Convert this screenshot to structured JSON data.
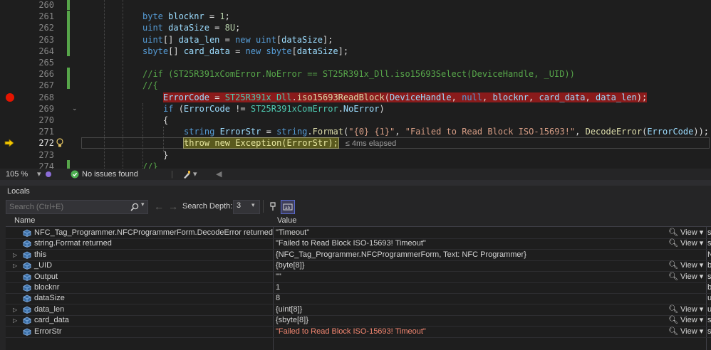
{
  "editor": {
    "lines": [
      {
        "num": "260",
        "tokens": []
      },
      {
        "num": "261",
        "tokens": [
          [
            "kw",
            "byte "
          ],
          [
            "var",
            "blocknr"
          ],
          [
            "pl",
            " = "
          ],
          [
            "num",
            "1"
          ],
          [
            "pl",
            ";"
          ]
        ]
      },
      {
        "num": "262",
        "tokens": [
          [
            "kw",
            "uint "
          ],
          [
            "var",
            "dataSize"
          ],
          [
            "pl",
            " = "
          ],
          [
            "num",
            "8U"
          ],
          [
            "pl",
            ";"
          ]
        ]
      },
      {
        "num": "263",
        "tokens": [
          [
            "kw",
            "uint"
          ],
          [
            "pl",
            "[] "
          ],
          [
            "var",
            "data_len"
          ],
          [
            "pl",
            " = "
          ],
          [
            "kw",
            "new "
          ],
          [
            "kw",
            "uint"
          ],
          [
            "pl",
            "["
          ],
          [
            "var",
            "dataSize"
          ],
          [
            "pl",
            "];"
          ]
        ]
      },
      {
        "num": "264",
        "tokens": [
          [
            "kw",
            "sbyte"
          ],
          [
            "pl",
            "[] "
          ],
          [
            "var",
            "card_data"
          ],
          [
            "pl",
            " = "
          ],
          [
            "kw",
            "new "
          ],
          [
            "kw",
            "sbyte"
          ],
          [
            "pl",
            "["
          ],
          [
            "var",
            "dataSize"
          ],
          [
            "pl",
            "];"
          ]
        ]
      },
      {
        "num": "265",
        "tokens": []
      },
      {
        "num": "266",
        "tokens": [
          [
            "cm",
            "//if (ST25R391xComError.NoError == ST25R391x_Dll.iso15693Select(DeviceHandle, _UID))"
          ]
        ]
      },
      {
        "num": "267",
        "tokens": [
          [
            "cm",
            "//{"
          ]
        ]
      },
      {
        "num": "268",
        "tokens": [
          [
            "var",
            "ErrorCode"
          ],
          [
            "pl",
            " = "
          ],
          [
            "ty",
            "ST25R391x_Dll"
          ],
          [
            "pl",
            "."
          ],
          [
            "fn",
            "iso15693ReadBlock"
          ],
          [
            "pl",
            "("
          ],
          [
            "var",
            "DeviceHandle"
          ],
          [
            "pl",
            ", "
          ],
          [
            "kw",
            "null"
          ],
          [
            "pl",
            ", "
          ],
          [
            "var",
            "blocknr"
          ],
          [
            "pl",
            ", "
          ],
          [
            "var",
            "card_data"
          ],
          [
            "pl",
            ", "
          ],
          [
            "var",
            "data_len"
          ],
          [
            "pl",
            ");"
          ]
        ]
      },
      {
        "num": "269",
        "tokens": [
          [
            "kw",
            "if "
          ],
          [
            "pl",
            "("
          ],
          [
            "var",
            "ErrorCode"
          ],
          [
            "pl",
            " != "
          ],
          [
            "ty",
            "ST25R391xComError"
          ],
          [
            "pl",
            "."
          ],
          [
            "var",
            "NoError"
          ],
          [
            "pl",
            ")"
          ]
        ]
      },
      {
        "num": "270",
        "tokens": [
          [
            "pl",
            "{"
          ]
        ]
      },
      {
        "num": "271",
        "tokens": [
          [
            "kw",
            "string "
          ],
          [
            "var",
            "ErrorStr"
          ],
          [
            "pl",
            " = "
          ],
          [
            "kw",
            "string"
          ],
          [
            "pl",
            "."
          ],
          [
            "fn",
            "Format"
          ],
          [
            "pl",
            "("
          ],
          [
            "str",
            "\"{0} {1}\""
          ],
          [
            "pl",
            ", "
          ],
          [
            "str",
            "\"Failed to Read Block ISO-15693!\""
          ],
          [
            "pl",
            ", "
          ],
          [
            "fn",
            "DecodeError"
          ],
          [
            "pl",
            "("
          ],
          [
            "var",
            "ErrorCode"
          ],
          [
            "pl",
            "));"
          ]
        ]
      },
      {
        "num": "272",
        "tokens": [
          [
            "kw",
            "throw "
          ],
          [
            "kw",
            "new "
          ],
          [
            "ty",
            "Exception"
          ],
          [
            "pl",
            "("
          ],
          [
            "var",
            "ErrorStr"
          ],
          [
            "pl",
            ");"
          ]
        ]
      },
      {
        "num": "273",
        "tokens": [
          [
            "pl",
            "}"
          ]
        ]
      },
      {
        "num": "274",
        "tokens": [
          [
            "cm",
            "//}"
          ]
        ]
      }
    ],
    "elapsed": "≤ 4ms elapsed"
  },
  "status": {
    "zoom": "105 %",
    "issues": "No issues found"
  },
  "locals": {
    "title": "Locals",
    "search_placeholder": "Search (Ctrl+E)",
    "depth_label": "Search Depth:",
    "depth_value": "3",
    "col_name": "Name",
    "col_value": "Value",
    "view_label": "View",
    "rows": [
      {
        "name": "NFC_Tag_Programmer.NFCProgrammerForm.DecodeError returned",
        "value": "\"Timeout\"",
        "expandable": false,
        "view": true,
        "changed": false,
        "type": "s"
      },
      {
        "name": "string.Format returned",
        "value": "\"Failed to Read Block ISO-15693! Timeout\"",
        "expandable": false,
        "view": true,
        "changed": false,
        "type": "s"
      },
      {
        "name": "this",
        "value": "{NFC_Tag_Programmer.NFCProgrammerForm, Text: NFC Programmer}",
        "expandable": true,
        "view": false,
        "changed": false,
        "type": "N"
      },
      {
        "name": "_UID",
        "value": "{byte[8]}",
        "expandable": true,
        "view": true,
        "changed": false,
        "type": "b"
      },
      {
        "name": "Output",
        "value": "\"\"",
        "expandable": false,
        "view": true,
        "changed": false,
        "type": "s"
      },
      {
        "name": "blocknr",
        "value": "1",
        "expandable": false,
        "view": false,
        "changed": false,
        "type": "b"
      },
      {
        "name": "dataSize",
        "value": "8",
        "expandable": false,
        "view": false,
        "changed": false,
        "type": "u"
      },
      {
        "name": "data_len",
        "value": "{uint[8]}",
        "expandable": true,
        "view": true,
        "changed": false,
        "type": "u"
      },
      {
        "name": "card_data",
        "value": "{sbyte[8]}",
        "expandable": true,
        "view": true,
        "changed": false,
        "type": "s"
      },
      {
        "name": "ErrorStr",
        "value": "\"Failed to Read Block ISO-15693! Timeout\"",
        "expandable": false,
        "view": true,
        "changed": true,
        "type": "s"
      }
    ]
  },
  "colors": {
    "breakpoint": "#e51400",
    "breakpoint_line": "#8a1b1b",
    "current_arrow": "#f5c800",
    "changed_value": "#f48771",
    "change_bar": "#57a64a"
  },
  "icons": [
    "breakpoint-icon",
    "execution-arrow-icon",
    "lightbulb-icon",
    "fold-chevron-icon",
    "ok-check-icon",
    "search-icon",
    "back-arrow-icon",
    "forward-arrow-icon",
    "cube-icon",
    "magnifier-icon"
  ]
}
